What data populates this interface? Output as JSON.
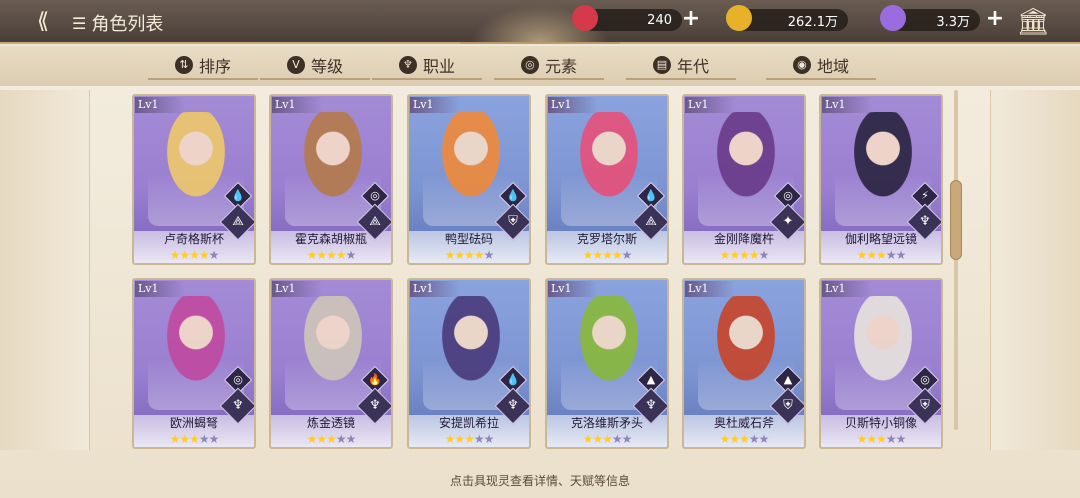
{
  "header": {
    "title": "角色列表",
    "currencies": [
      {
        "name": "ticket",
        "value": "240",
        "icon": "ticket-icon",
        "color": "#d43a4a"
      },
      {
        "name": "gold",
        "value": "262.1万",
        "icon": "coin-icon",
        "color": "#e7b22a"
      },
      {
        "name": "crystal",
        "value": "3.3万",
        "icon": "crystal-icon",
        "color": "#9b6be0"
      }
    ]
  },
  "filters": [
    {
      "label": "排序",
      "icon": "sort-icon",
      "glyph": "⇅"
    },
    {
      "label": "等级",
      "icon": "level-icon",
      "glyph": "V"
    },
    {
      "label": "职业",
      "icon": "class-icon",
      "glyph": "♆"
    },
    {
      "label": "元素",
      "icon": "element-icon",
      "glyph": "◎"
    },
    {
      "label": "年代",
      "icon": "era-icon",
      "glyph": "▤"
    },
    {
      "label": "地域",
      "icon": "region-icon",
      "glyph": "◉"
    }
  ],
  "cards": [
    {
      "lv": "Lv1",
      "name": "卢奇格斯杯",
      "stars": 4,
      "bg": "purple",
      "elem": "💧",
      "job": "⟁",
      "hair": "#f0c96a"
    },
    {
      "lv": "Lv1",
      "name": "霍克森胡椒瓶",
      "stars": 4,
      "bg": "purple",
      "elem": "◎",
      "job": "⟁",
      "hair": "#b57b4a"
    },
    {
      "lv": "Lv1",
      "name": "鸭型砝码",
      "stars": 4,
      "bg": "blue",
      "elem": "💧",
      "job": "⛨",
      "hair": "#f08a3a"
    },
    {
      "lv": "Lv1",
      "name": "克罗塔尔斯",
      "stars": 4,
      "bg": "blue",
      "elem": "💧",
      "job": "⟁",
      "hair": "#e8507a"
    },
    {
      "lv": "Lv1",
      "name": "金刚降魔杵",
      "stars": 4,
      "bg": "purple",
      "elem": "◎",
      "job": "✦",
      "hair": "#6a3a8a"
    },
    {
      "lv": "Lv1",
      "name": "伽利略望远镜",
      "stars": 3,
      "bg": "purple",
      "elem": "⚡",
      "job": "♆",
      "hair": "#2a2440"
    },
    {
      "lv": "Lv1",
      "name": "欧洲蝎弩",
      "stars": 3,
      "bg": "purple",
      "elem": "◎",
      "job": "♆",
      "hair": "#c04aa0"
    },
    {
      "lv": "Lv1",
      "name": "炼金透镜",
      "stars": 3,
      "bg": "purple",
      "elem": "🔥",
      "job": "♆",
      "hair": "#cfc6b8"
    },
    {
      "lv": "Lv1",
      "name": "安提凯希拉",
      "stars": 3,
      "bg": "blue",
      "elem": "💧",
      "job": "♆",
      "hair": "#4a3a7a"
    },
    {
      "lv": "Lv1",
      "name": "克洛维斯矛头",
      "stars": 3,
      "bg": "blue",
      "elem": "▲",
      "job": "♆",
      "hair": "#8ab83a"
    },
    {
      "lv": "Lv1",
      "name": "奥杜威石斧",
      "stars": 3,
      "bg": "blue",
      "elem": "▲",
      "job": "⛨",
      "hair": "#c8442a"
    },
    {
      "lv": "Lv1",
      "name": "贝斯特小铜像",
      "stars": 3,
      "bg": "purple",
      "elem": "◎",
      "job": "⛨",
      "hair": "#e8e4de"
    }
  ],
  "footer": "点击具现灵查看详情、天赋等信息"
}
